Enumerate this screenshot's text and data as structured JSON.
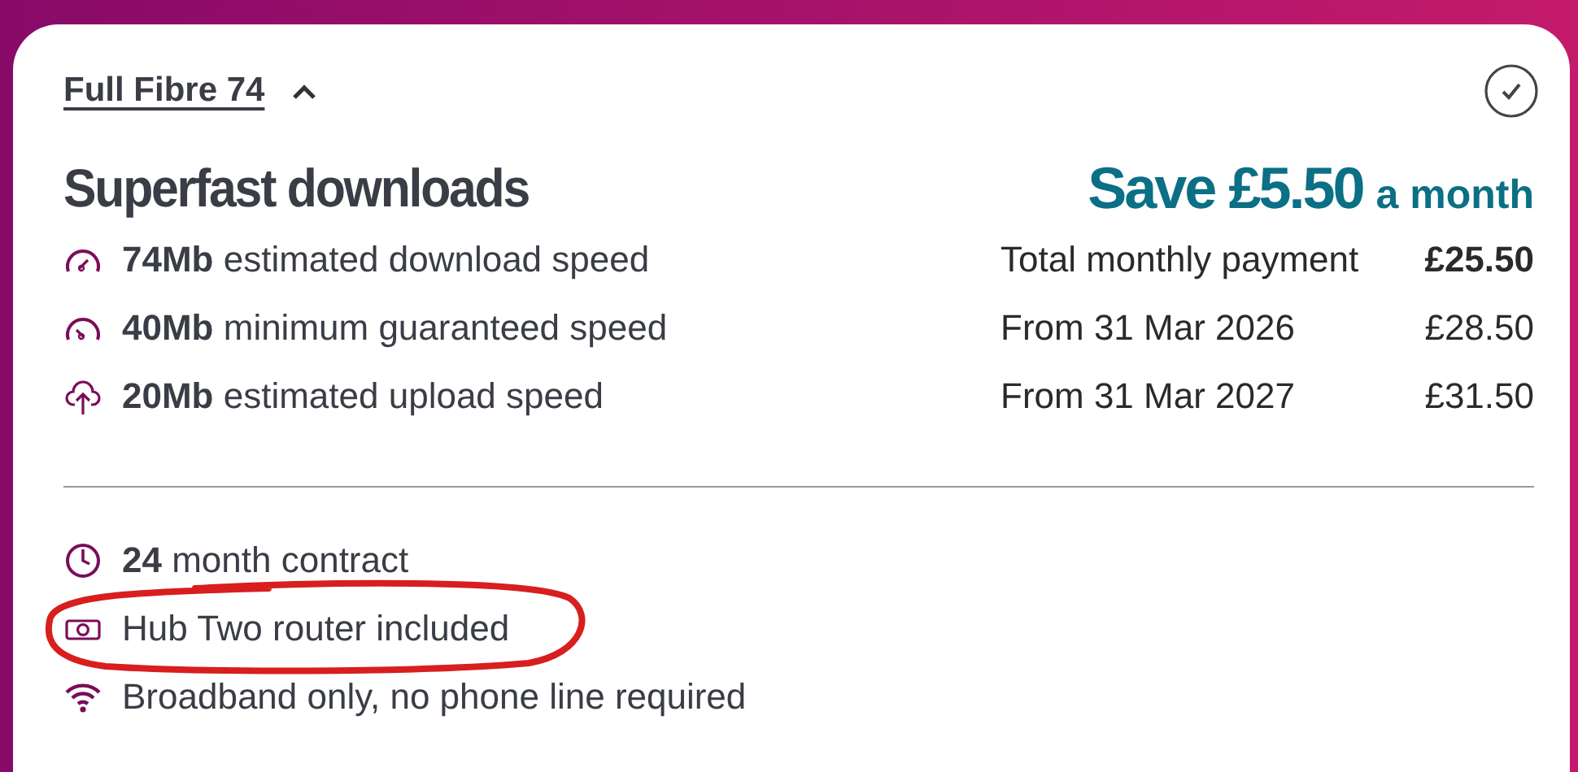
{
  "plan": {
    "name": "Full Fibre 74",
    "expanded": true
  },
  "headline": "Superfast downloads",
  "saving": {
    "amount": "Save £5.50",
    "period": "a month"
  },
  "speeds": [
    {
      "kind": "download",
      "text": "**74Mb** estimated download speed"
    },
    {
      "kind": "minimum",
      "text": "**40Mb** minimum guaranteed speed"
    },
    {
      "kind": "upload",
      "text": "**20Mb** estimated upload speed"
    }
  ],
  "prices": [
    {
      "label": "Total monthly payment",
      "amount": "£25.50",
      "bold": true
    },
    {
      "label": "From 31 Mar 2026",
      "amount": "£28.50",
      "bold": false
    },
    {
      "label": "From 31 Mar 2027",
      "amount": "£31.50",
      "bold": false
    }
  ],
  "features": [
    {
      "kind": "contract",
      "text": "**24** month contract",
      "highlighted": false
    },
    {
      "kind": "router",
      "text": "Hub Two router included",
      "highlighted": true
    },
    {
      "kind": "connection",
      "text": "Broadband only, no phone line required",
      "highlighted": false
    }
  ]
}
